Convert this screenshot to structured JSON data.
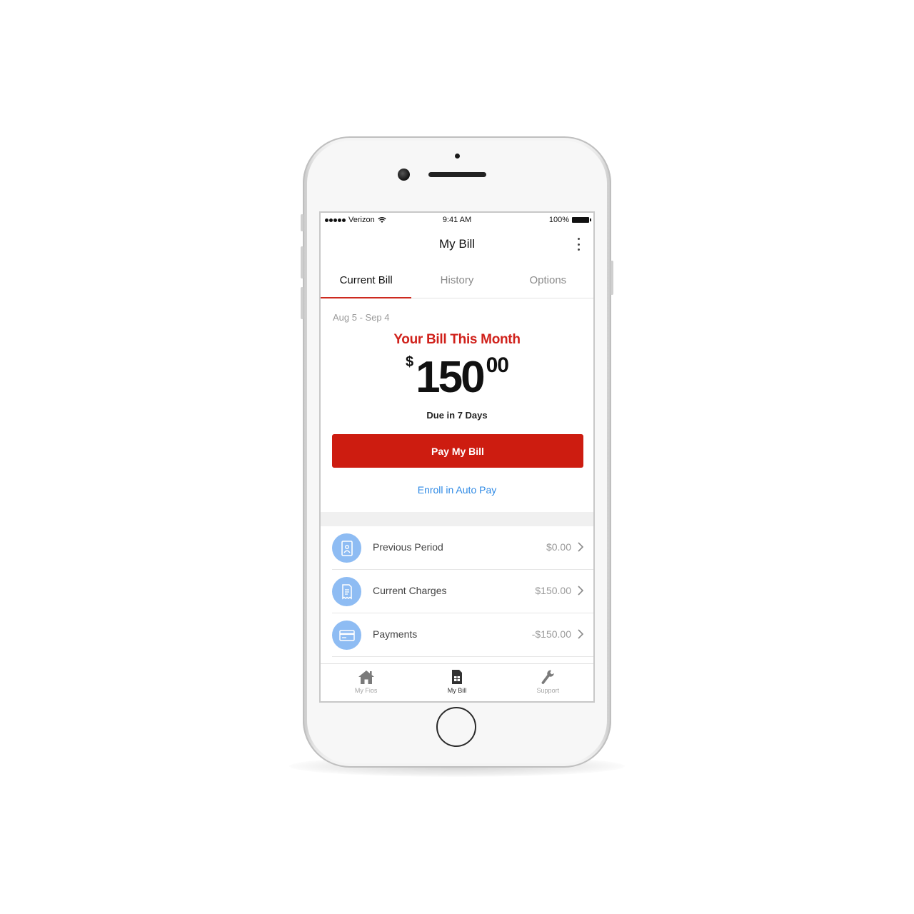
{
  "status_bar": {
    "carrier": "Verizon",
    "time": "9:41 AM",
    "battery": "100%"
  },
  "header": {
    "title": "My Bill",
    "menu_icon": "more-vertical-icon"
  },
  "tabs": [
    {
      "label": "Current Bill",
      "active": true
    },
    {
      "label": "History",
      "active": false
    },
    {
      "label": "Options",
      "active": false
    }
  ],
  "bill": {
    "period": "Aug 5 - Sep 4",
    "heading": "Your Bill This Month",
    "currency_symbol": "$",
    "amount_dollars": "150",
    "amount_cents": "00",
    "due_text": "Due in 7 Days",
    "pay_button_label": "Pay My Bill",
    "autopay_link": "Enroll in Auto Pay"
  },
  "breakdown": [
    {
      "label": "Previous Period",
      "value": "$0.00",
      "icon": "document-icon"
    },
    {
      "label": "Current Charges",
      "value": "$150.00",
      "icon": "receipt-icon"
    },
    {
      "label": "Payments",
      "value": "-$150.00",
      "icon": "credit-card-icon"
    }
  ],
  "bottom_nav": [
    {
      "label": "My Fios",
      "icon": "home-icon",
      "active": false
    },
    {
      "label": "My Bill",
      "icon": "bill-icon",
      "active": true
    },
    {
      "label": "Support",
      "icon": "wrench-icon",
      "active": false
    }
  ],
  "colors": {
    "brand_red": "#cd1c10",
    "link_blue": "#2f8ae5",
    "icon_blue": "#8ebcf3"
  }
}
